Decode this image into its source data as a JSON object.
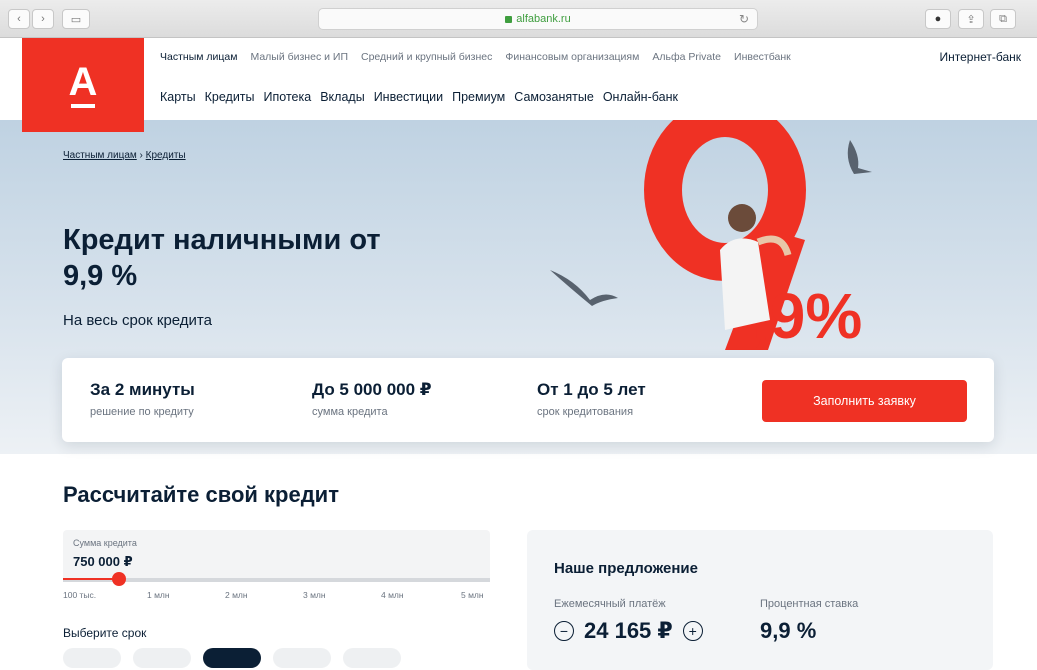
{
  "browser": {
    "url": "alfabank.ru"
  },
  "header": {
    "logo_letter": "А",
    "topnav": [
      "Частным лицам",
      "Малый бизнес и ИП",
      "Средний и крупный бизнес",
      "Финансовым организациям",
      "Альфа Private",
      "Инвестбанк"
    ],
    "internet_bank": "Интернет-банк",
    "subnav": [
      "Карты",
      "Кредиты",
      "Ипотека",
      "Вклады",
      "Инвестиции",
      "Премиум",
      "Самозанятые",
      "Онлайн-банк"
    ]
  },
  "hero": {
    "breadcrumb": {
      "root": "Частным лицам",
      "sep": "›",
      "current": "Кредиты"
    },
    "title": "Кредит наличными от 9,9 %",
    "subtitle": "На весь срок кредита",
    "art_text": ",9%",
    "accent_color": "#ef3124"
  },
  "facts": [
    {
      "big": "За 2 минуты",
      "small": "решение по кредиту"
    },
    {
      "big": "До 5 000 000 ₽",
      "small": "сумма кредита"
    },
    {
      "big": "От 1 до 5 лет",
      "small": "срок кредитования"
    }
  ],
  "apply_button": "Заполнить заявку",
  "calculator": {
    "title": "Рассчитайте свой кредит",
    "amount_label": "Сумма кредита",
    "amount_value": "750 000 ₽",
    "slider_fraction": 0.13,
    "ticks": [
      "100 тыс.",
      "1 млн",
      "2 млн",
      "3 млн",
      "4 млн",
      "5 млн"
    ],
    "term_label": "Выберите срок"
  },
  "offer": {
    "title": "Наше предложение",
    "payment_label": "Ежемесячный платёж",
    "payment_value": "24 165 ₽",
    "rate_label": "Процентная ставка",
    "rate_value": "9,9 %",
    "minus": "−",
    "plus": "+"
  }
}
